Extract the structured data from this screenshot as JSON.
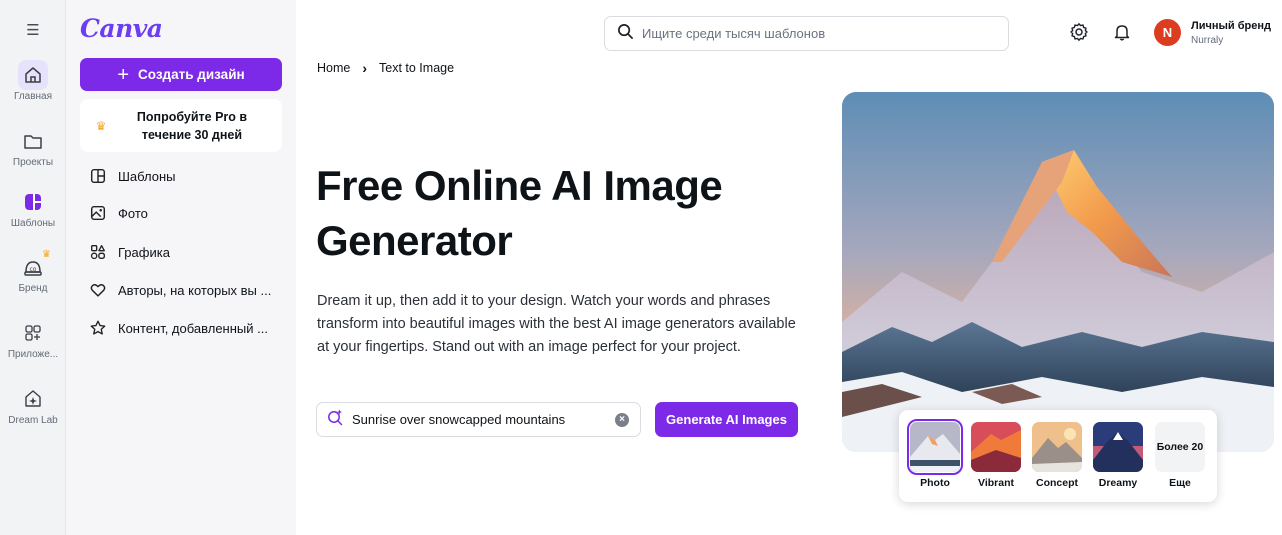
{
  "colors": {
    "brand": "#7d2ae8",
    "avatar": "#dc3c1f",
    "logo": "#6c3df1"
  },
  "rail": {
    "items": [
      {
        "label": "Главная",
        "icon": "home-icon"
      },
      {
        "label": "Проекты",
        "icon": "folder-icon"
      },
      {
        "label": "Шаблоны",
        "icon": "templates-icon"
      },
      {
        "label": "Бренд",
        "icon": "brand-icon"
      },
      {
        "label": "Приложе...",
        "icon": "apps-icon"
      },
      {
        "label": "Dream Lab",
        "icon": "dream-lab-icon"
      }
    ]
  },
  "panel": {
    "logo": "Canva",
    "create_label": "Создать дизайн",
    "pro_label": "Попробуйте Pro в течение 30 дней",
    "nav": [
      {
        "label": "Шаблоны",
        "icon": "template-icon"
      },
      {
        "label": "Фото",
        "icon": "photo-icon"
      },
      {
        "label": "Графика",
        "icon": "graphics-icon"
      },
      {
        "label": "Авторы, на которых вы ...",
        "icon": "heart-icon"
      },
      {
        "label": "Контент, добавленный ...",
        "icon": "star-icon"
      }
    ]
  },
  "header": {
    "search_placeholder": "Ищите среди тысяч шаблонов",
    "avatar_initial": "N",
    "brand_name": "Личный бренд",
    "brand_sub": "Nurraly"
  },
  "breadcrumb": {
    "home": "Home",
    "current": "Text to Image"
  },
  "hero": {
    "title": "Free Online AI Image Generator",
    "description": "Dream it up, then add it to your design. Watch your words and phrases transform into beautiful images with the best AI image generators available at your fingertips. Stand out with an image perfect for your project.",
    "prompt_value": "Sunrise over snowcapped mountains",
    "generate_label": "Generate AI Images"
  },
  "styles": {
    "options": [
      {
        "label": "Photo",
        "selected": true
      },
      {
        "label": "Vibrant",
        "selected": false
      },
      {
        "label": "Concept",
        "selected": false
      },
      {
        "label": "Dreamy",
        "selected": false
      }
    ],
    "more_thumb": "Более 20",
    "more_label": "Еще"
  }
}
